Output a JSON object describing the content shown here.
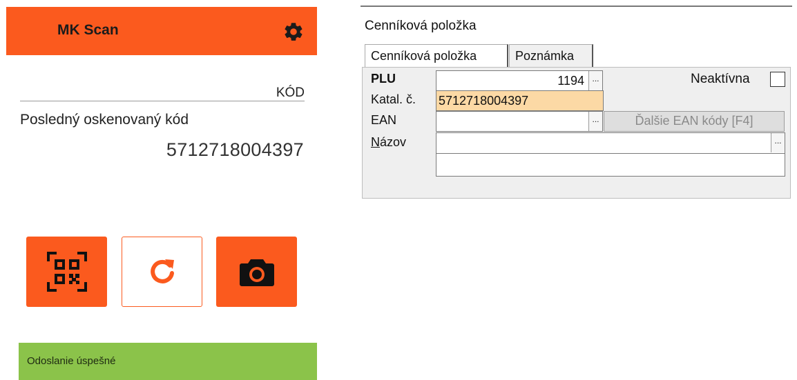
{
  "mobile": {
    "app_title": "MK Scan",
    "settings_icon": "gear-icon",
    "code_field_label": "KÓD",
    "last_scanned_label": "Posledný oskenovaný kód",
    "last_scanned_value": "5712718004397",
    "buttons": {
      "scan_icon": "qr-code-icon",
      "refresh_icon": "refresh-icon",
      "camera_icon": "camera-icon"
    },
    "toast": "Odoslanie úspešné",
    "colors": {
      "accent": "#fb5a1e",
      "success": "#8bc34a"
    }
  },
  "desktop": {
    "window_title": "Cenníková položka",
    "tabs": [
      {
        "label": "Cenníková položka",
        "active": true
      },
      {
        "label": "Poznámka",
        "active": false
      }
    ],
    "fields": {
      "plu_label": "PLU",
      "plu_value": "1194",
      "katal_label": "Katal. č.",
      "katal_value": "5712718004397",
      "ean_label": "EAN",
      "ean_value": "",
      "nazov_label_first": "N",
      "nazov_label_rest": "ázov",
      "nazov_value": "",
      "nazov_value_2": ""
    },
    "lookup_button": "...",
    "more_ean_button": "Ďalšie EAN kódy  [F4]",
    "inactive_label": "Neaktívna",
    "inactive_checked": false
  }
}
